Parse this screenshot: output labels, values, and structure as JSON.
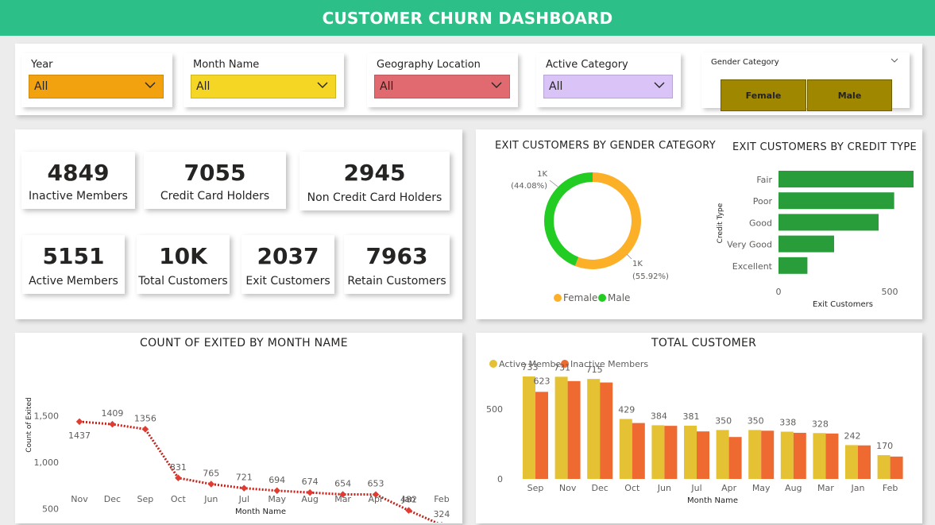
{
  "header": {
    "title": "CUSTOMER CHURN DASHBOARD"
  },
  "filters": {
    "year": {
      "label": "Year",
      "value": "All",
      "color": "#f2a20f"
    },
    "month": {
      "label": "Month Name",
      "value": "All",
      "color": "#f6d625"
    },
    "geography": {
      "label": "Geography Location",
      "value": "All",
      "color": "#e06a70"
    },
    "active": {
      "label": "Active Category",
      "value": "All",
      "color": "#d9c3f7"
    },
    "gender": {
      "label": "Gender Category",
      "options": [
        "Female",
        "Male"
      ],
      "color": "#a08700"
    }
  },
  "kpis": {
    "inactive": {
      "value": "4849",
      "label": "Inactive Members"
    },
    "credit": {
      "value": "7055",
      "label": "Credit Card Holders"
    },
    "noncredit": {
      "value": "2945",
      "label": "Non Credit Card Holders"
    },
    "active": {
      "value": "5151",
      "label": "Active Members"
    },
    "total": {
      "value": "10K",
      "label": "Total Customers"
    },
    "exit": {
      "value": "2037",
      "label": "Exit Customers"
    },
    "retain": {
      "value": "7963",
      "label": "Retain Customers"
    }
  },
  "chart_data": [
    {
      "id": "gender_donut",
      "type": "pie",
      "title": "EXIT CUSTOMERS BY GENDER CATEGORY",
      "categories": [
        "Female",
        "Male"
      ],
      "values": [
        55.92,
        44.08
      ],
      "value_labels": [
        "1K",
        "1K"
      ],
      "pct_labels": [
        "(55.92%)",
        "(44.08%)"
      ],
      "colors": [
        "#fbb028",
        "#22cc22"
      ],
      "legend": "bottom"
    },
    {
      "id": "credit_type",
      "type": "bar",
      "orientation": "horizontal",
      "title": "EXIT CUSTOMERS BY CREDIT TYPE",
      "categories": [
        "Fair",
        "Poor",
        "Good",
        "Very Good",
        "Excellent"
      ],
      "values": [
        685,
        520,
        450,
        250,
        130
      ],
      "xlabel": "Exit Customers",
      "ylabel": "Credit Type",
      "xticks": [
        "0",
        "500"
      ],
      "xlim": [
        0,
        700
      ],
      "color": "#2a9d3b"
    },
    {
      "id": "exited_by_month",
      "type": "line",
      "title": "COUNT OF EXITED BY MONTH NAME",
      "categories": [
        "Nov",
        "Dec",
        "Sep",
        "Oct",
        "Jun",
        "Jul",
        "May",
        "Aug",
        "Mar",
        "Apr",
        "Jan",
        "Feb"
      ],
      "values": [
        1437,
        1409,
        1356,
        831,
        765,
        721,
        694,
        674,
        654,
        653,
        482,
        324
      ],
      "xlabel": "Month Name",
      "ylabel": "Count of Exited",
      "yticks": [
        "1,500",
        "1,000",
        "500"
      ],
      "ylim": [
        250,
        1650
      ],
      "color": "#c0231b"
    },
    {
      "id": "total_customer",
      "type": "bar",
      "title": "TOTAL CUSTOMER",
      "categories": [
        "Sep",
        "Nov",
        "Dec",
        "Oct",
        "Jun",
        "Jul",
        "Apr",
        "May",
        "Aug",
        "Mar",
        "Jan",
        "Feb"
      ],
      "series": [
        {
          "name": "Active Member",
          "values": [
            733,
            731,
            715,
            429,
            384,
            381,
            350,
            350,
            338,
            328,
            242,
            170
          ],
          "color": "#e5c134"
        },
        {
          "name": "Inactive Members",
          "values": [
            623,
            700,
            690,
            400,
            380,
            340,
            300,
            345,
            330,
            325,
            240,
            160
          ],
          "color": "#ee6a31"
        }
      ],
      "data_labels": [
        "733",
        "623",
        "731",
        "715",
        "429",
        "384",
        "381",
        "350",
        "350",
        "338",
        "328",
        "242",
        "170"
      ],
      "xlabel": "Month Name",
      "yticks": [
        "500",
        "0"
      ],
      "ylim": [
        0,
        850
      ],
      "legend": "top-left"
    }
  ]
}
